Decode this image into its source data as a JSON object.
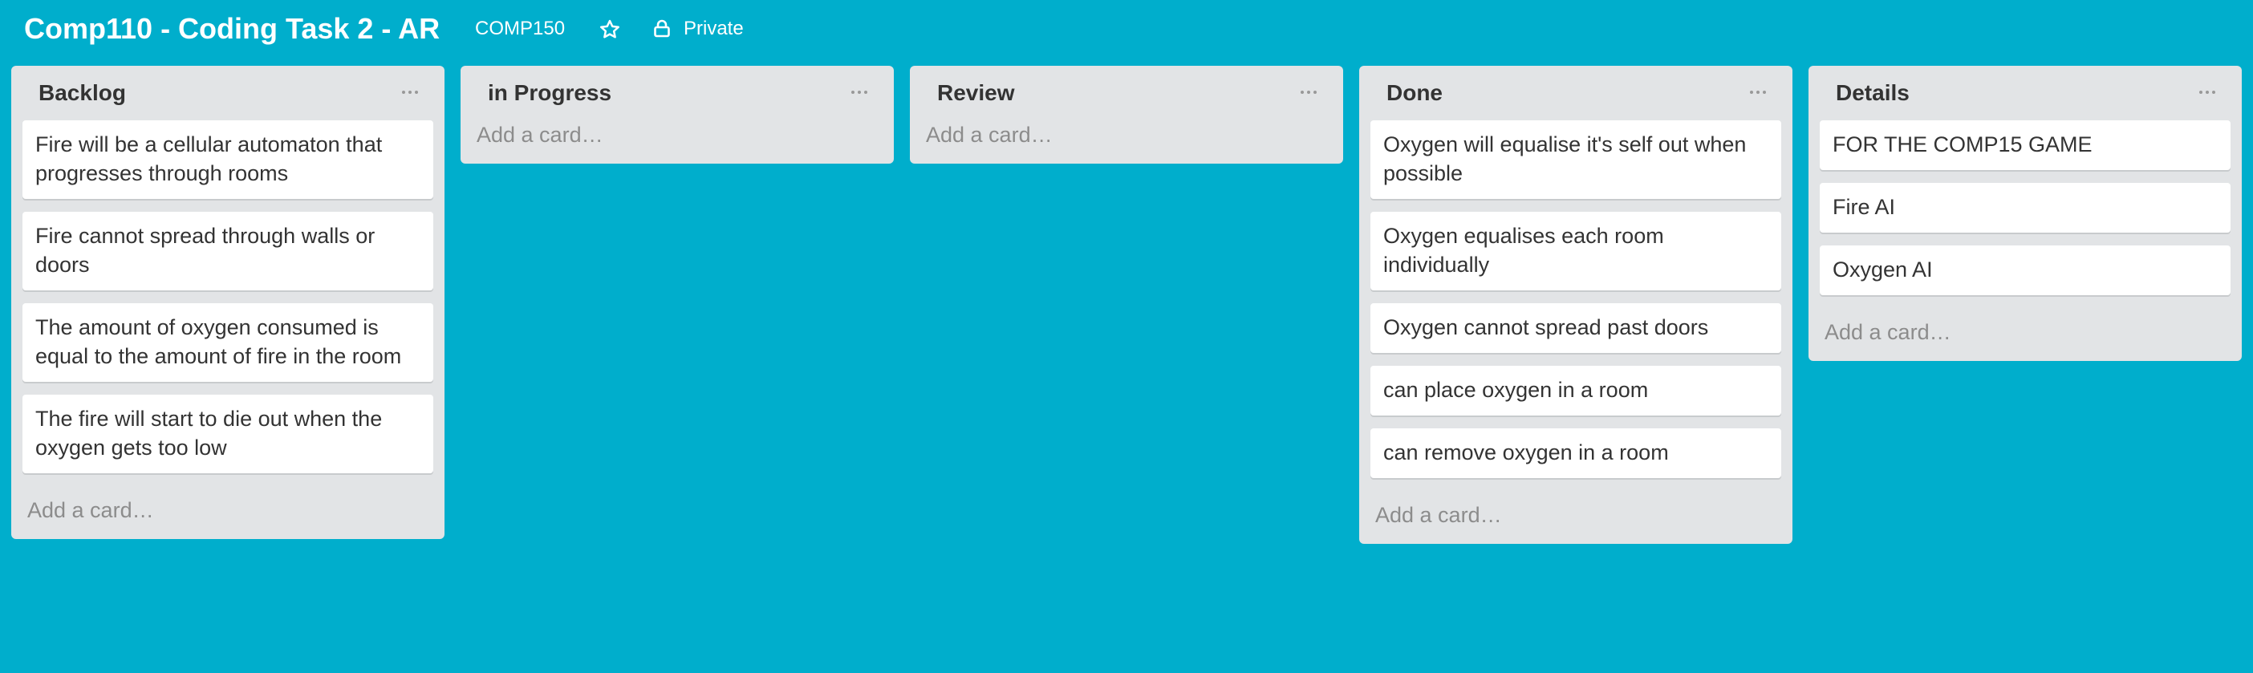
{
  "board": {
    "title": "Comp110 - Coding Task 2 - AR",
    "org": "COMP150",
    "privacy": "Private"
  },
  "icons": {
    "star": "star-icon",
    "lock": "lock-icon",
    "menu": "ellipsis-icon"
  },
  "colors": {
    "background": "#00AECC",
    "list_bg": "#E2E4E6",
    "card_bg": "#FFFFFF"
  },
  "lists": [
    {
      "title": "Backlog",
      "cards": [
        "Fire will be a cellular automaton that progresses through rooms",
        "Fire cannot spread through walls or doors",
        "The amount of oxygen consumed is equal to the amount of fire in the room",
        "The fire will start to die out when the oxygen gets too low"
      ],
      "add_card": "Add a card…"
    },
    {
      "title": "in Progress",
      "cards": [],
      "add_card": "Add a card…"
    },
    {
      "title": "Review",
      "cards": [],
      "add_card": "Add a card…"
    },
    {
      "title": "Done",
      "cards": [
        "Oxygen will equalise it's self out when possible",
        "Oxygen equalises each room individually",
        "Oxygen cannot spread past doors",
        "can place oxygen in a room",
        "can remove oxygen in a room"
      ],
      "add_card": "Add a card…"
    },
    {
      "title": "Details",
      "cards": [
        "FOR THE COMP15 GAME",
        "Fire AI",
        "Oxygen AI"
      ],
      "add_card": "Add a card…"
    }
  ]
}
